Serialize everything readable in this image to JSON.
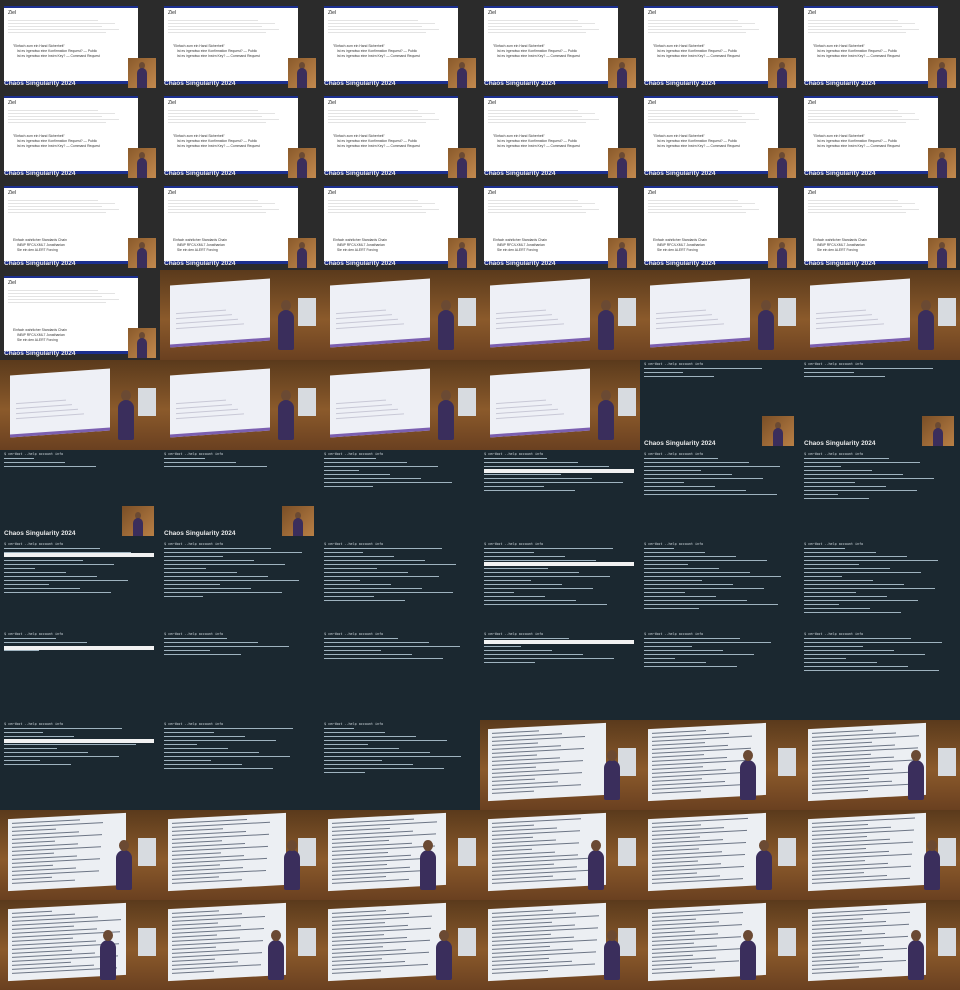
{
  "tiles": {
    "caption": "Chaos Singularity 2024",
    "slide_title": "Ziel",
    "slide_a_lines": [
      "\"Einfach zum ein Hand Sicherheit\"",
      "Ist es irgendwo eine Konfirmation Request? — Public",
      "Ist es irgendwo eine Instrn Key? — Command Request"
    ],
    "slide_b_lines": [
      "Einfach wahrlicher Standards Chain",
      "INBIP RFC/LXML7 Jonathanian",
      "Sie ein den ALERT Forcing"
    ],
    "terminal_prompt": "$ certbot --help account info"
  },
  "layout": {
    "rows": [
      [
        "slideA",
        "slideA",
        "slideA",
        "slideA",
        "slideA",
        "slideA"
      ],
      [
        "slideA",
        "slideA",
        "slideA",
        "slideA",
        "slideA",
        "slideA"
      ],
      [
        "slideB",
        "slideB",
        "slideB",
        "slideB",
        "slideB",
        "slideB"
      ],
      [
        "slideB",
        "roomSlide",
        "roomSlide",
        "roomSlide",
        "roomSlide",
        "roomSlide"
      ],
      [
        "roomSlide",
        "roomSlide",
        "roomSlide",
        "roomSlide",
        "termCam",
        "termCam"
      ],
      [
        "termCam",
        "termCam",
        "term",
        "term",
        "term",
        "term"
      ],
      [
        "term",
        "term",
        "term",
        "term",
        "term",
        "term"
      ],
      [
        "term",
        "term",
        "term",
        "term",
        "term",
        "term"
      ],
      [
        "term",
        "term",
        "term",
        "roomTerm",
        "roomTerm",
        "roomTerm"
      ],
      [
        "roomTerm",
        "roomTerm",
        "roomTerm",
        "roomTerm",
        "roomTerm",
        "roomTerm"
      ],
      [
        "roomTerm",
        "roomTerm",
        "roomTerm",
        "roomTerm",
        "roomTerm",
        "roomTerm"
      ]
    ]
  },
  "colors": {
    "slide_bar": "#1c2f8f",
    "terminal_bg": "#1b2830",
    "speaker_shirt": "#3a2e5c"
  }
}
